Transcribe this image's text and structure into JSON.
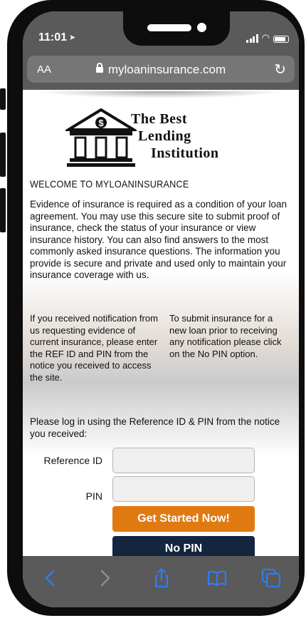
{
  "status_bar": {
    "time": "11:01"
  },
  "browser": {
    "text_size_label": "AA",
    "url": "myloaninsurance.com"
  },
  "brand": {
    "line1": "The Best",
    "line2": "Lending",
    "line3": "Institution",
    "emblem_symbol": "$"
  },
  "page": {
    "welcome_heading": "WELCOME TO MYLOANINSURANCE",
    "intro": "Evidence of insurance is required as a condition of your loan agreement. You may use this secure site to submit proof of insurance, check the status of your insurance or view insurance history. You can also find answers to the most commonly asked insurance questions. The information you provide is secure and private and used only to maintain your insurance coverage with us.",
    "left_column": "If you received notification from us requesting evidence of current insurance, please enter the REF ID and PIN from the notice you received to access the site.",
    "right_column": "To submit insurance for a new loan prior to receiving any notification please click on the No PIN option.",
    "login_prompt": "Please log in using the Reference ID & PIN from the notice you received:"
  },
  "form": {
    "reference_id_label": "Reference ID",
    "pin_label": "PIN",
    "reference_id_value": "",
    "pin_value": "",
    "get_started_label": "Get Started Now!",
    "no_pin_label": "No PIN"
  },
  "toolbar": {
    "icons": [
      "back-icon",
      "forward-icon",
      "share-icon",
      "bookmarks-icon",
      "tabs-icon"
    ]
  },
  "colors": {
    "accent_orange": "#e07a10",
    "navy": "#13253f",
    "ios_blue": "#2f7bf5",
    "chrome_gray": "#5a5a5a"
  }
}
